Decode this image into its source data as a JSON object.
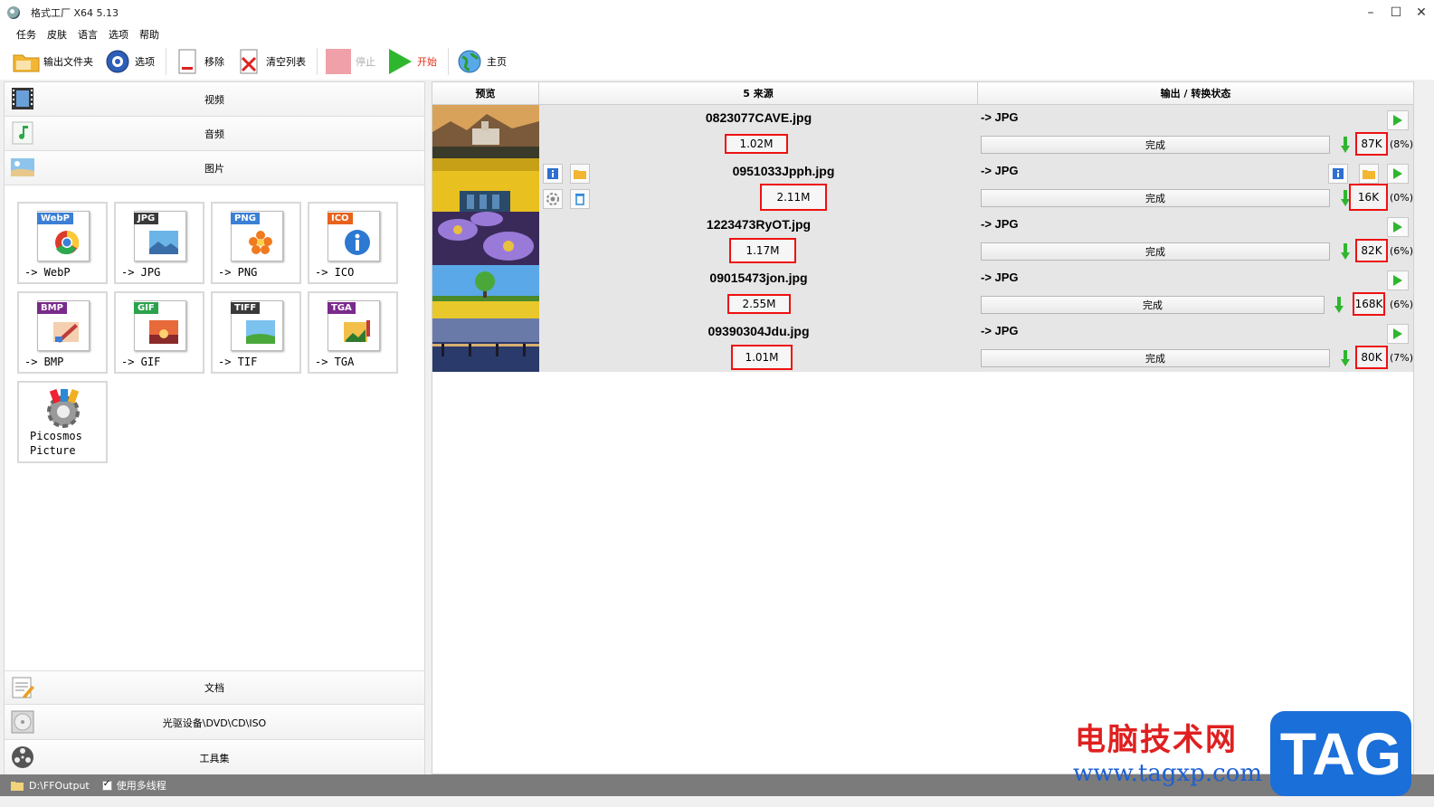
{
  "window": {
    "title": "格式工厂 X64 5.13",
    "minimize": "–",
    "maximize": "☐",
    "close": "✕"
  },
  "menu": [
    "任务",
    "皮肤",
    "语言",
    "选项",
    "帮助"
  ],
  "toolbar": {
    "output_folder": "输出文件夹",
    "options": "选项",
    "remove": "移除",
    "clear_list": "清空列表",
    "stop": "停止",
    "start": "开始",
    "home": "主页"
  },
  "categories": {
    "video": "视频",
    "audio": "音频",
    "image": "图片",
    "document": "文档",
    "disc": "光驱设备\\DVD\\CD\\ISO",
    "tools": "工具集"
  },
  "formats": [
    {
      "tag": "WebP",
      "label": "-> WebP",
      "color": "#3b7fd6"
    },
    {
      "tag": "JPG",
      "label": "-> JPG",
      "color": "#3a3a3a"
    },
    {
      "tag": "PNG",
      "label": "-> PNG",
      "color": "#3b7fd6"
    },
    {
      "tag": "ICO",
      "label": "-> ICO",
      "color": "#e8621c"
    },
    {
      "tag": "BMP",
      "label": "-> BMP",
      "color": "#7a2a8a"
    },
    {
      "tag": "GIF",
      "label": "-> GIF",
      "color": "#2ba24c"
    },
    {
      "tag": "TIFF",
      "label": "-> TIF",
      "color": "#3a3a3a"
    },
    {
      "tag": "TGA",
      "label": "-> TGA",
      "color": "#7a2a8a"
    }
  ],
  "picosmos": {
    "line1": "Picosmos",
    "line2": "Picture"
  },
  "table": {
    "col_preview": "预览",
    "col_source": "5 来源",
    "col_output": "输出 / 转换状态"
  },
  "rows": [
    {
      "name": "0823077CAVE.jpg",
      "size": "1.02M",
      "output": "-> JPG",
      "status": "完成",
      "out_size": "87K",
      "pct": "(8%)"
    },
    {
      "name": "0951033Jpph.jpg",
      "size": "2.11M",
      "output": "-> JPG",
      "status": "完成",
      "out_size": "16K",
      "pct": "(0%)"
    },
    {
      "name": "1223473RyOT.jpg",
      "size": "1.17M",
      "output": "-> JPG",
      "status": "完成",
      "out_size": "82K",
      "pct": "(6%)"
    },
    {
      "name": "09015473jon.jpg",
      "size": "2.55M",
      "output": "-> JPG",
      "status": "完成",
      "out_size": "168K",
      "pct": "(6%)"
    },
    {
      "name": "09390304Jdu.jpg",
      "size": "1.01M",
      "output": "-> JPG",
      "status": "完成",
      "out_size": "80K",
      "pct": "(7%)"
    }
  ],
  "statusbar": {
    "path": "D:\\FFOutput",
    "multithread": "使用多线程"
  },
  "watermark": {
    "line1": "电脑技术网",
    "line2": "www.tagxp.com",
    "tag": "TAG"
  }
}
